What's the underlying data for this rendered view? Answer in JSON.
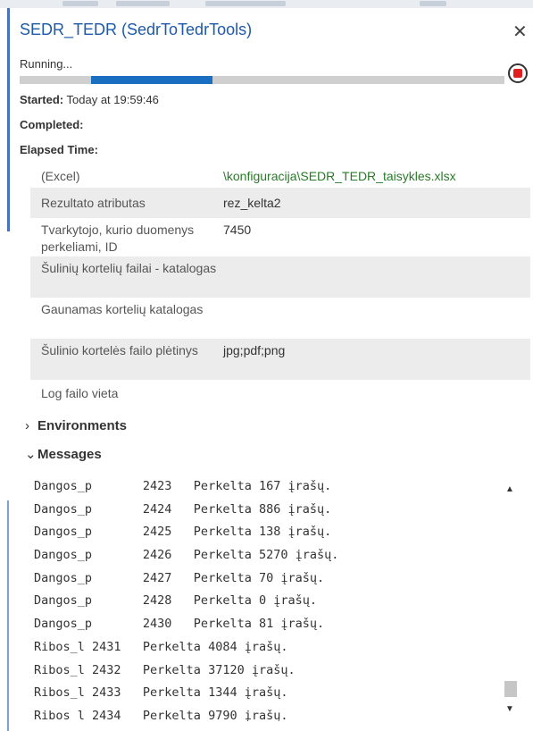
{
  "window": {
    "title": "SEDR_TEDR (SedrToTedrTools)",
    "close_icon": "close-icon"
  },
  "status": {
    "running": "Running...",
    "progress_fraction": 0.3,
    "started_label": "Started:",
    "started_value": "Today at 19:59:46",
    "completed_label": "Completed:",
    "elapsed_label": "Elapsed Time:"
  },
  "params": [
    {
      "key": "(Excel)",
      "value": "\\konfiguracija\\SEDR_TEDR_taisykles.xlsx"
    },
    {
      "key": "Rezultato atributas",
      "value": "rez_kelta2"
    },
    {
      "key": "Tvarkytojo, kurio duomenys perkeliami, ID",
      "value": "7450"
    },
    {
      "key": "Šulinių kortelių failai - katalogas",
      "value": ""
    },
    {
      "key": "Gaunamas kortelių katalogas",
      "value": ""
    },
    {
      "key": "Šulinio kortelės failo plėtinys",
      "value": "jpg;pdf;png"
    },
    {
      "key": "Log failo vieta",
      "value": ""
    }
  ],
  "sections": {
    "environments": "Environments",
    "messages": "Messages"
  },
  "messages": [
    "Dangos_p       2423   Perkelta 167 įrašų.",
    "Dangos_p       2424   Perkelta 886 įrašų.",
    "Dangos_p       2425   Perkelta 138 įrašų.",
    "Dangos_p       2426   Perkelta 5270 įrašų.",
    "Dangos_p       2427   Perkelta 70 įrašų.",
    "Dangos_p       2428   Perkelta 0 įrašų.",
    "Dangos_p       2430   Perkelta 81 įrašų.",
    "Ribos_l 2431   Perkelta 4084 įrašų.",
    "Ribos_l 2432   Perkelta 37120 įrašų.",
    "Ribos_l 2433   Perkelta 1344 įrašų.",
    "Ribos_l 2434   Perkelta 9790 įrašų."
  ],
  "colors": {
    "title": "#1e5aa8",
    "progress": "#1a6fc1",
    "stop": "#e02020",
    "path": "#2a7a2a"
  }
}
